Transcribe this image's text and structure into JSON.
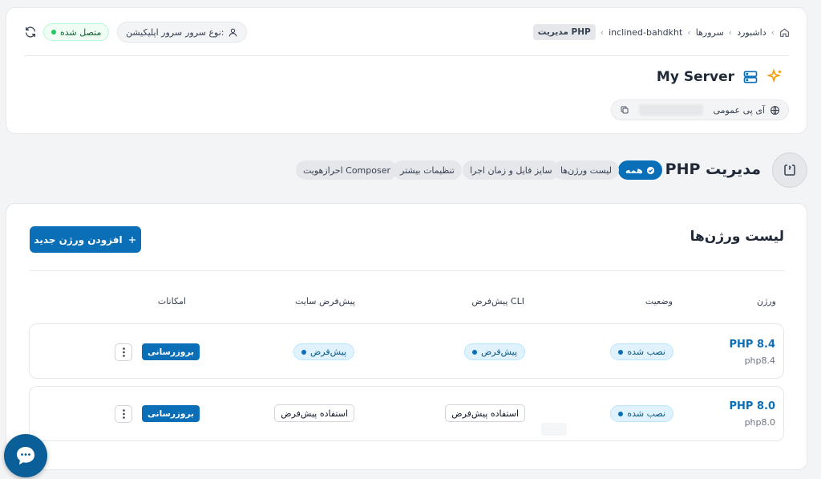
{
  "breadcrumb": {
    "items": [
      "داشبورد",
      "سرورها",
      "inclined-bahdkht"
    ],
    "current": "مدیریت PHP"
  },
  "header": {
    "connection_status": "متصل شده",
    "server_type_label": "نوع سرور:",
    "server_type_value": "سرور اپلیکیشن",
    "server_name": "My Server",
    "public_ip_label": "آی پی عمومی"
  },
  "page": {
    "title": "مدیریت PHP",
    "tabs": [
      {
        "label": "همه",
        "active": true
      },
      {
        "label": "لیست ورژن‌ها",
        "active": false
      },
      {
        "label": "سایز فایل و زمان اجرا",
        "active": false
      },
      {
        "label": "تنظیمات بیشتر",
        "active": false
      },
      {
        "label": "احرازهویت Composer",
        "active": false
      }
    ]
  },
  "versions_panel": {
    "title": "لیست ورژن‌ها",
    "add_button_label": "افزودن ورژن جدید",
    "columns": {
      "version": "ورژن",
      "status": "وضعیت",
      "cli_default": "پیش‌فرض CLI",
      "site_default": "پیش‌فرض سایت",
      "actions": "امکانات"
    },
    "rows": [
      {
        "name": "PHP 8.4",
        "id": "php8.4",
        "status": "نصب شده",
        "cli_default": "پیش‌فرض",
        "site_default": "پیش‌فرض",
        "update_label": "بروزرسانی"
      },
      {
        "name": "PHP 8.0",
        "id": "php8.0",
        "status": "نصب شده",
        "cli_default": "استفاده پیش‌فرض",
        "site_default": "استفاده پیش‌فرض",
        "update_label": "بروزرسانی"
      }
    ]
  },
  "colors": {
    "accent": "#0b6fb8",
    "success": "#22c55e",
    "chat_button": "#0b5f99"
  },
  "icons": {
    "home": "home-icon",
    "refresh": "refresh-icon",
    "user": "user-icon",
    "sparkle": "sparkle-icon",
    "server": "server-icon",
    "globe": "globe-icon",
    "copy": "copy-icon",
    "php_page": "file-code-icon",
    "check": "check-circle-icon",
    "plus": "plus-icon",
    "more": "more-vertical-icon",
    "chat": "chat-icon"
  }
}
